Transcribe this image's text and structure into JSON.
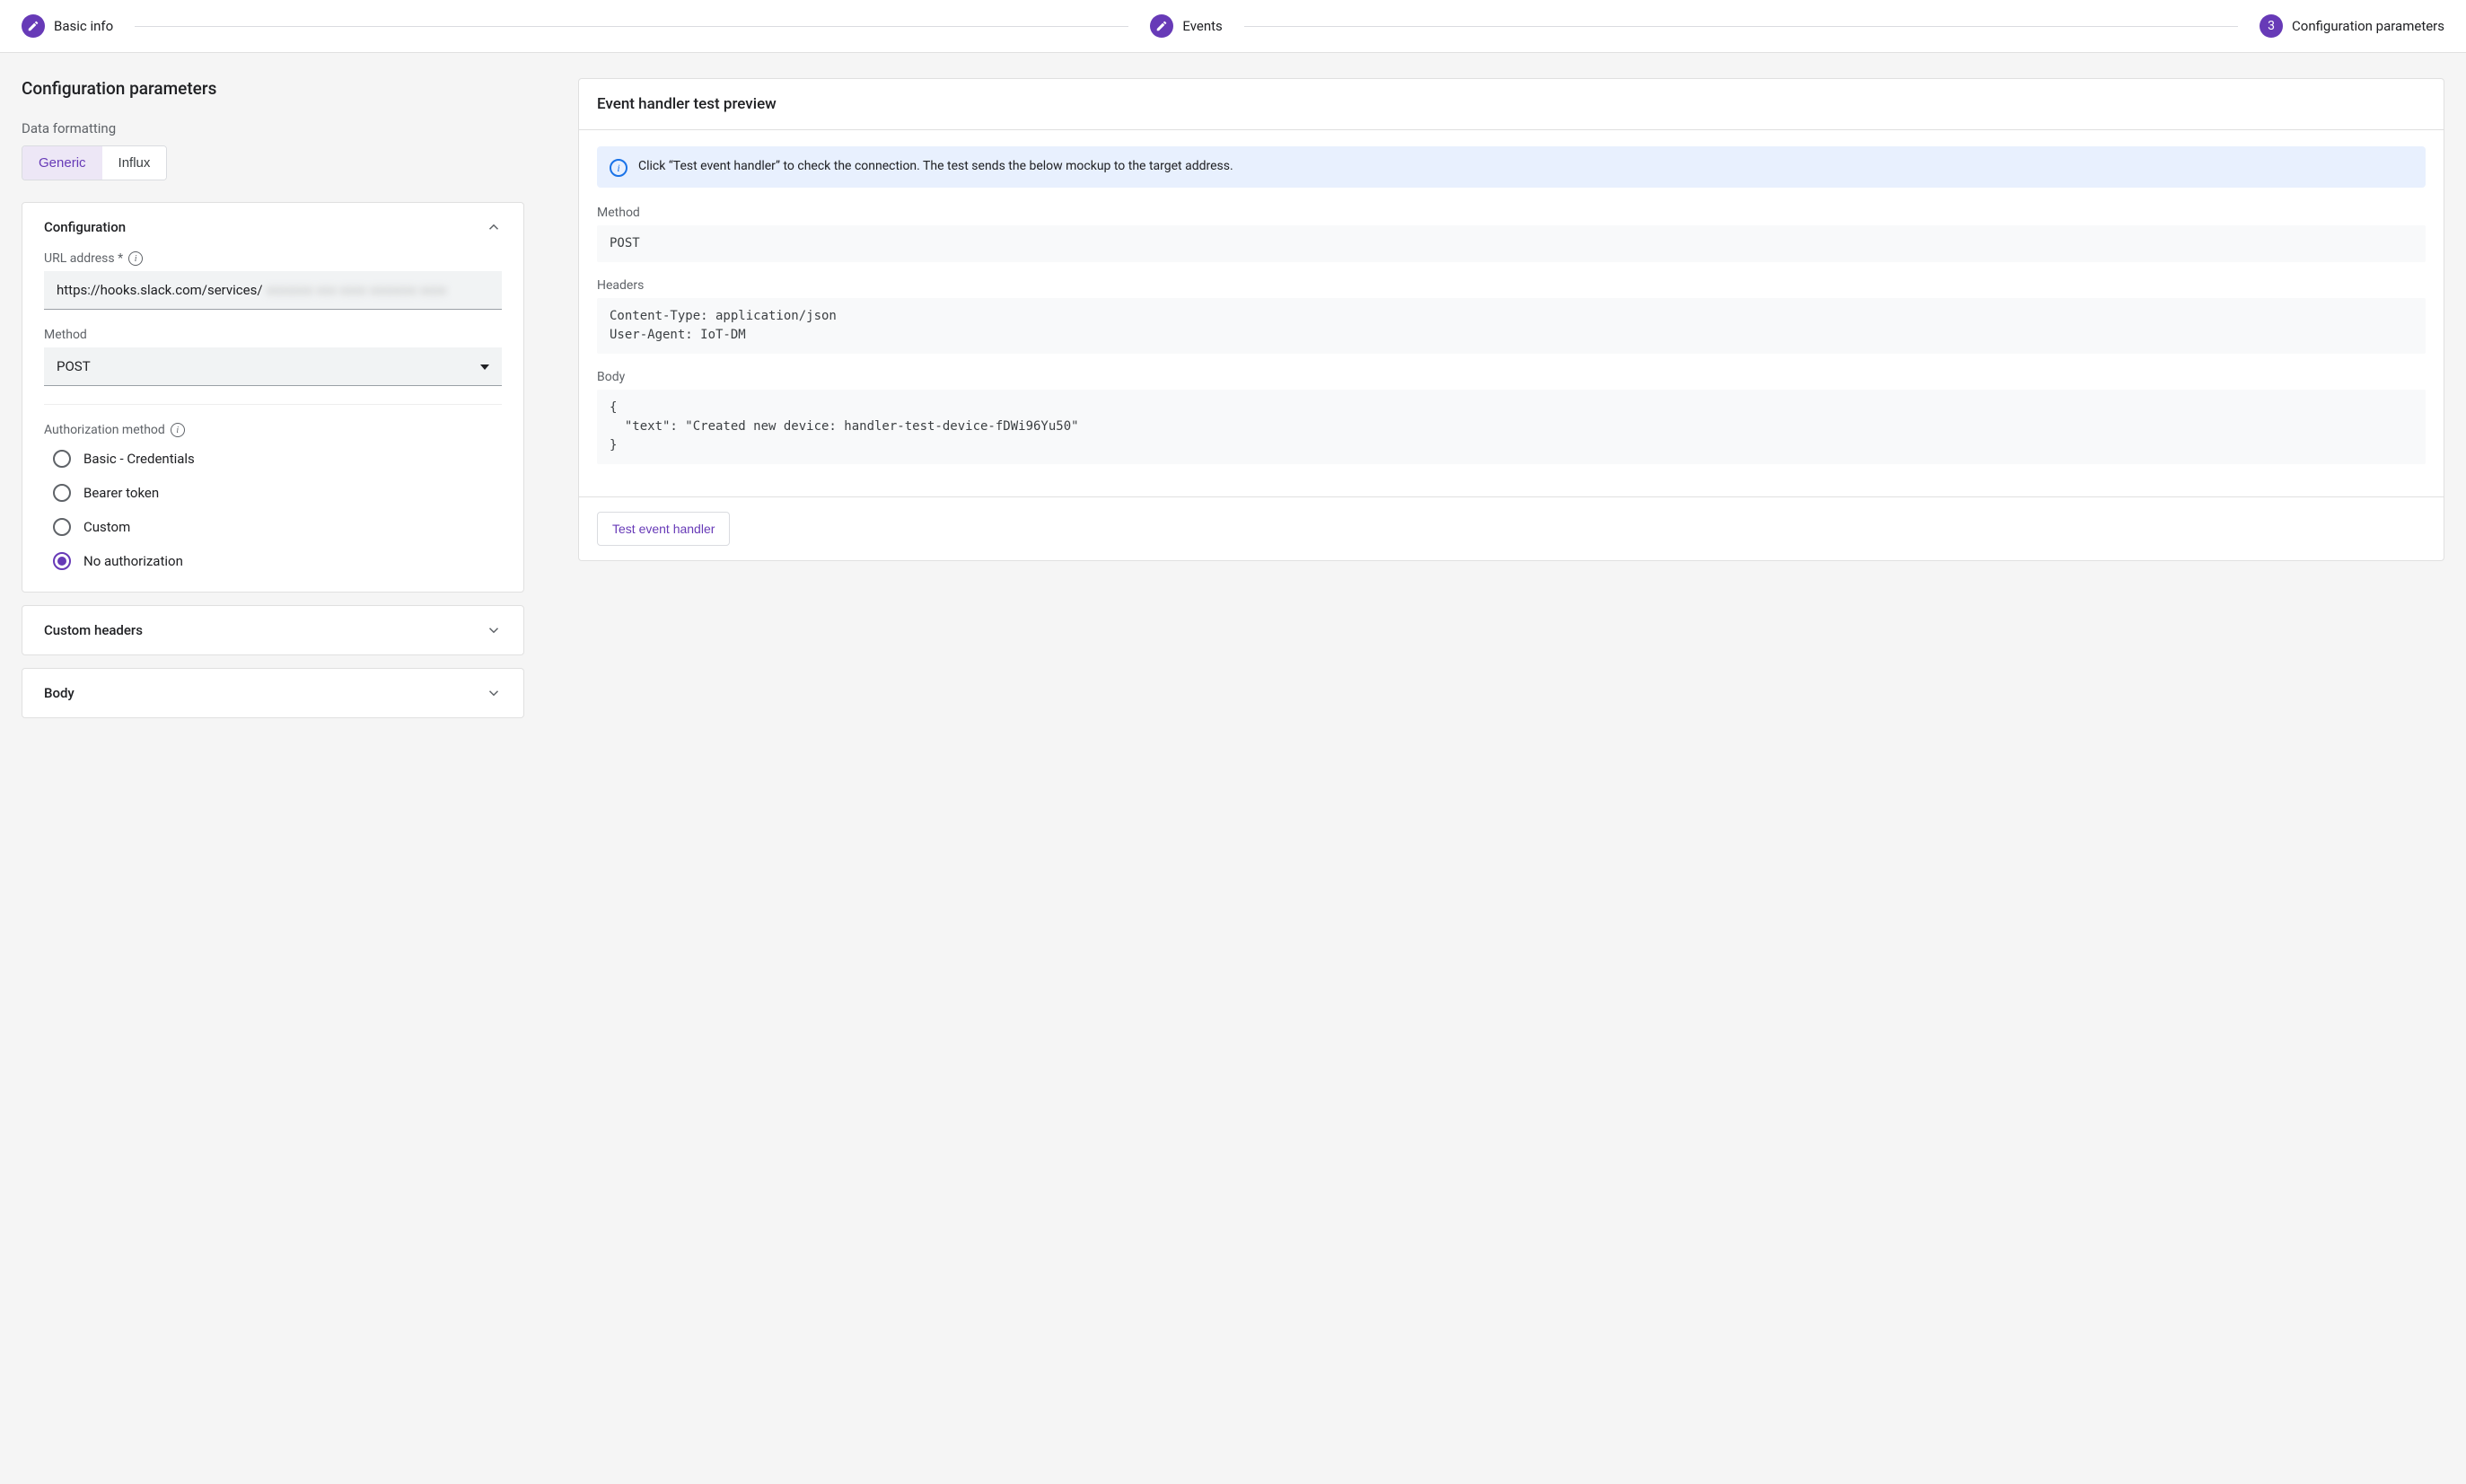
{
  "stepper": {
    "step1_label": "Basic info",
    "step2_label": "Events",
    "step3_number": "3",
    "step3_label": "Configuration parameters"
  },
  "page_title": "Configuration parameters",
  "data_formatting": {
    "label": "Data formatting",
    "options": {
      "generic": "Generic",
      "influx": "Influx"
    }
  },
  "config_panel": {
    "title": "Configuration",
    "url_label": "URL address *",
    "url_value": "https://hooks.slack.com/services/",
    "url_redacted_placeholder": "xxxxxxx xxx xxxx xxxxxxx xxxx",
    "method_label": "Method",
    "method_value": "POST",
    "auth_label": "Authorization method",
    "auth_options": {
      "basic": "Basic - Credentials",
      "bearer": "Bearer token",
      "custom": "Custom",
      "none": "No authorization"
    },
    "auth_selected": "none"
  },
  "custom_headers_title": "Custom headers",
  "body_title": "Body",
  "preview": {
    "title": "Event handler test preview",
    "info_text": "Click “Test event handler” to check the connection. The test sends the below mockup to the target address.",
    "method_label": "Method",
    "method_value": "POST",
    "headers_label": "Headers",
    "headers_value": "Content-Type: application/json\nUser-Agent: IoT-DM",
    "body_label": "Body",
    "body_value": "{\n  \"text\": \"Created new device: handler-test-device-fDWi96Yu50\"\n}",
    "test_button": "Test event handler"
  }
}
